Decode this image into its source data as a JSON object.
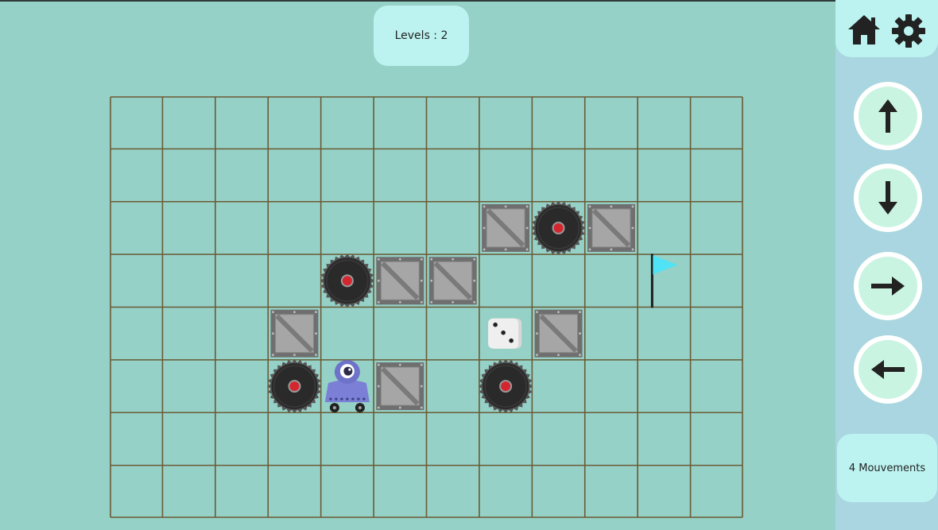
{
  "header": {
    "level_label": "Levels : 2"
  },
  "hud": {
    "moves_label": "4 Mouvements"
  },
  "menu": {
    "icons": [
      "home-icon",
      "gear-icon"
    ]
  },
  "controls": [
    {
      "name": "up-arrow-button",
      "icon": "arrow-up-icon",
      "direction": "up"
    },
    {
      "name": "down-arrow-button",
      "icon": "arrow-down-icon",
      "direction": "down"
    },
    {
      "name": "right-arrow-button",
      "icon": "arrow-right-icon",
      "direction": "right"
    },
    {
      "name": "left-arrow-button",
      "icon": "arrow-left-icon",
      "direction": "left"
    }
  ],
  "board": {
    "cols": 12,
    "rows": 8,
    "objects": [
      {
        "type": "crate",
        "col": 7,
        "row": 2
      },
      {
        "type": "saw",
        "col": 8,
        "row": 2
      },
      {
        "type": "crate",
        "col": 9,
        "row": 2
      },
      {
        "type": "saw",
        "col": 4,
        "row": 3
      },
      {
        "type": "crate",
        "col": 5,
        "row": 3
      },
      {
        "type": "crate",
        "col": 6,
        "row": 3
      },
      {
        "type": "flag",
        "col": 10,
        "row": 3
      },
      {
        "type": "crate",
        "col": 3,
        "row": 4
      },
      {
        "type": "dice",
        "col": 7,
        "row": 4
      },
      {
        "type": "crate",
        "col": 8,
        "row": 4
      },
      {
        "type": "saw",
        "col": 3,
        "row": 5
      },
      {
        "type": "robot",
        "col": 4,
        "row": 5
      },
      {
        "type": "crate",
        "col": 5,
        "row": 5
      },
      {
        "type": "saw",
        "col": 7,
        "row": 5
      }
    ]
  },
  "colors": {
    "background": "#95d1c7",
    "grid_line": "#6b5a35",
    "panel": "#bcf3f0",
    "sidebar": "#a9d6e0",
    "button_fill": "#c9f4e2",
    "flag": "#4fe3f5",
    "robot": "#7b7fd6",
    "saw_center": "#d3262e"
  }
}
